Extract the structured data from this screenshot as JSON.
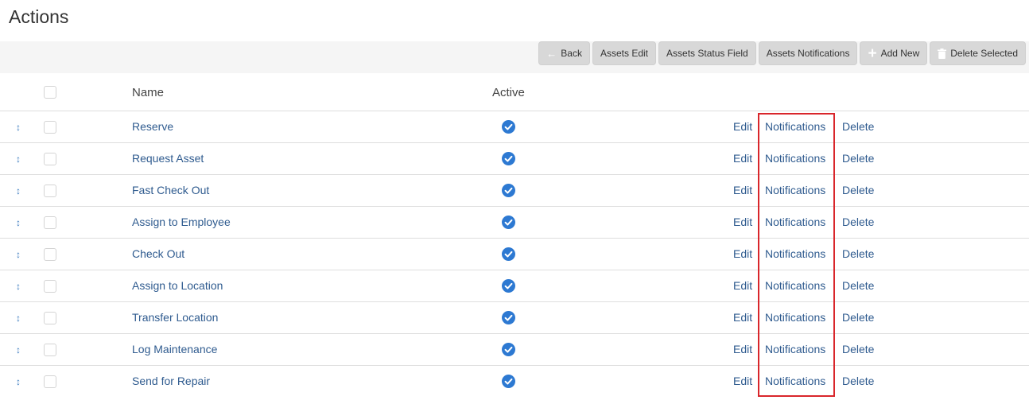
{
  "page": {
    "title": "Actions"
  },
  "toolbar": {
    "back_label": "Back",
    "assets_edit_label": "Assets Edit",
    "assets_status_field_label": "Assets Status Field",
    "assets_notifications_label": "Assets Notifications",
    "add_new_label": "Add New",
    "delete_selected_label": "Delete Selected"
  },
  "table": {
    "columns": {
      "name": "Name",
      "active": "Active"
    },
    "rows": [
      {
        "name": "Reserve",
        "active": true,
        "edit": "Edit",
        "notifications": "Notifications",
        "delete": "Delete"
      },
      {
        "name": "Request Asset",
        "active": true,
        "edit": "Edit",
        "notifications": "Notifications",
        "delete": "Delete"
      },
      {
        "name": "Fast Check Out",
        "active": true,
        "edit": "Edit",
        "notifications": "Notifications",
        "delete": "Delete"
      },
      {
        "name": "Assign to Employee",
        "active": true,
        "edit": "Edit",
        "notifications": "Notifications",
        "delete": "Delete"
      },
      {
        "name": "Check Out",
        "active": true,
        "edit": "Edit",
        "notifications": "Notifications",
        "delete": "Delete"
      },
      {
        "name": "Assign to Location",
        "active": true,
        "edit": "Edit",
        "notifications": "Notifications",
        "delete": "Delete"
      },
      {
        "name": "Transfer Location",
        "active": true,
        "edit": "Edit",
        "notifications": "Notifications",
        "delete": "Delete"
      },
      {
        "name": "Log Maintenance",
        "active": true,
        "edit": "Edit",
        "notifications": "Notifications",
        "delete": "Delete"
      },
      {
        "name": "Send for Repair",
        "active": true,
        "edit": "Edit",
        "notifications": "Notifications",
        "delete": "Delete"
      }
    ]
  },
  "colors": {
    "link": "#2f5b8f",
    "active_check": "#2d79d2",
    "highlight": "#d9262b",
    "toolbar_bg": "#f5f5f5",
    "button_bg": "#d8d8d8"
  }
}
